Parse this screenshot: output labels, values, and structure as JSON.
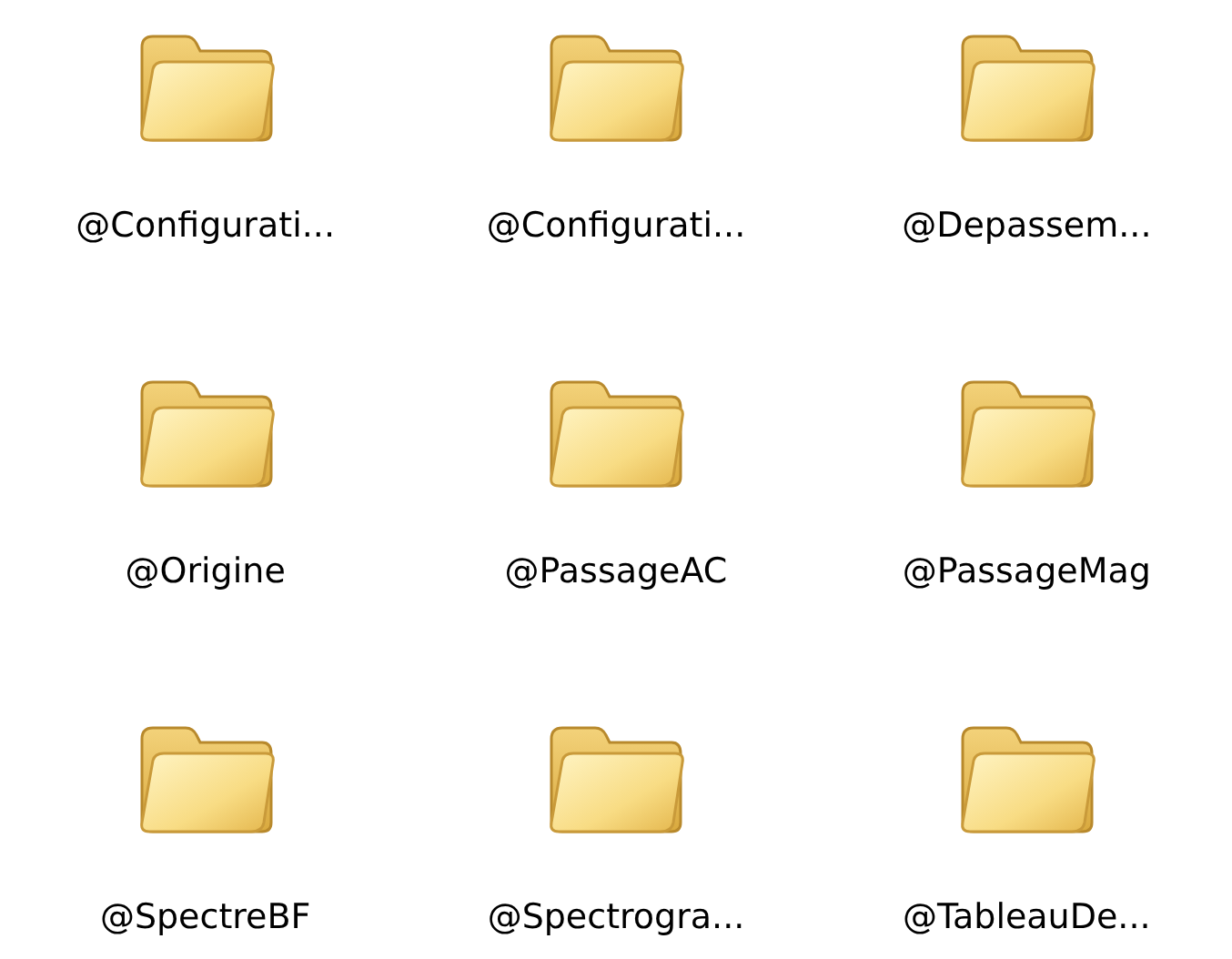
{
  "folders": [
    {
      "name": "@Configurati..."
    },
    {
      "name": "@Configurati..."
    },
    {
      "name": "@Depassem..."
    },
    {
      "name": "@Origine"
    },
    {
      "name": "@PassageAC"
    },
    {
      "name": "@PassageMag"
    },
    {
      "name": "@SpectreBF"
    },
    {
      "name": "@Spectrogra..."
    },
    {
      "name": "@TableauDe..."
    }
  ]
}
